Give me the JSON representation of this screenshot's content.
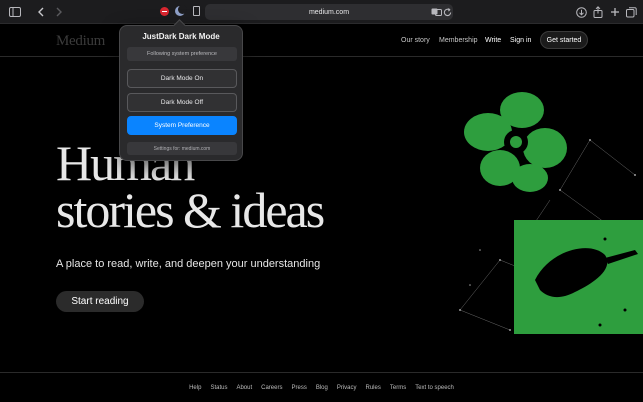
{
  "browser": {
    "url": "medium.com"
  },
  "site": {
    "logo": "Medium",
    "nav": {
      "our_story": "Our story",
      "membership": "Membership",
      "write": "Write",
      "sign_in": "Sign in",
      "get_started": "Get started"
    },
    "hero": {
      "title_line1": "Human",
      "title_line2": "stories & ideas",
      "subtitle": "A place to read, write, and deepen your understanding",
      "cta": "Start reading"
    },
    "footer": [
      "Help",
      "Status",
      "About",
      "Careers",
      "Press",
      "Blog",
      "Privacy",
      "Rules",
      "Terms",
      "Text to speech"
    ]
  },
  "popup": {
    "title": "JustDark Dark Mode",
    "status": "Following system preference",
    "buttons": {
      "on": "Dark Mode On",
      "off": "Dark Mode Off",
      "system": "System Preference"
    },
    "settings_for": "Settings for: medium.com"
  },
  "colors": {
    "accent_blue": "#0a84ff",
    "illustration_green": "#2e9e3e"
  }
}
